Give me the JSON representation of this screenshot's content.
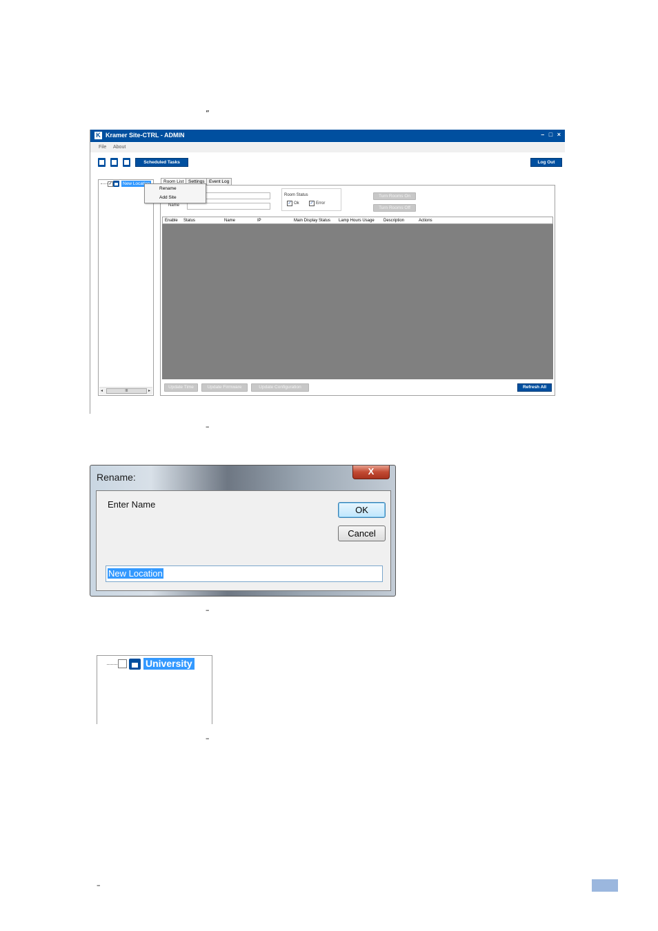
{
  "marks": {
    "q1": "”",
    "d1": "–",
    "d2": "–",
    "d3": "–",
    "d4": "–"
  },
  "main_window": {
    "title": "Kramer Site-CTRL - ADMIN",
    "window_controls": "– □ ×",
    "logo": "K",
    "menu": {
      "file": "File",
      "about": "About"
    },
    "toolbar": {
      "scheduled_tasks": "Scheduled Tasks",
      "log_out": "Log Out"
    },
    "tree": {
      "node_label": "New Location",
      "scroll_left": "◂",
      "scroll_mid": "III",
      "scroll_right": "▸"
    },
    "context_menu": {
      "rename": "Rename",
      "add_site": "Add Site"
    },
    "tabs": {
      "room_list": "Room List",
      "settings": "Settings",
      "event_log": "Event Log"
    },
    "filters": {
      "name_label": "Name",
      "room_status_label": "Room Status",
      "ok_label": "Ok",
      "error_label": "Error",
      "check": "✓"
    },
    "buttons": {
      "turn_rooms_on": "Turn Rooms On",
      "turn_rooms_off": "Turn Rooms Off",
      "update_time": "Update Time",
      "update_firmware": "Update Firmware",
      "update_configuration": "Update Configuration",
      "refresh_all": "Refresh All"
    },
    "columns": [
      "Enable",
      "Status",
      "Name",
      "IP",
      "Main Display Status",
      "Lamp Hours Usage",
      "Description",
      "Actions"
    ]
  },
  "rename_dialog": {
    "title": "Rename:",
    "close": "X",
    "prompt": "Enter Name",
    "ok": "OK",
    "cancel": "Cancel",
    "value": "New Location"
  },
  "tree_result": {
    "label": "University"
  },
  "colors": {
    "brand": "#004f9f",
    "selection": "#3399ff",
    "grid": "#808080"
  }
}
